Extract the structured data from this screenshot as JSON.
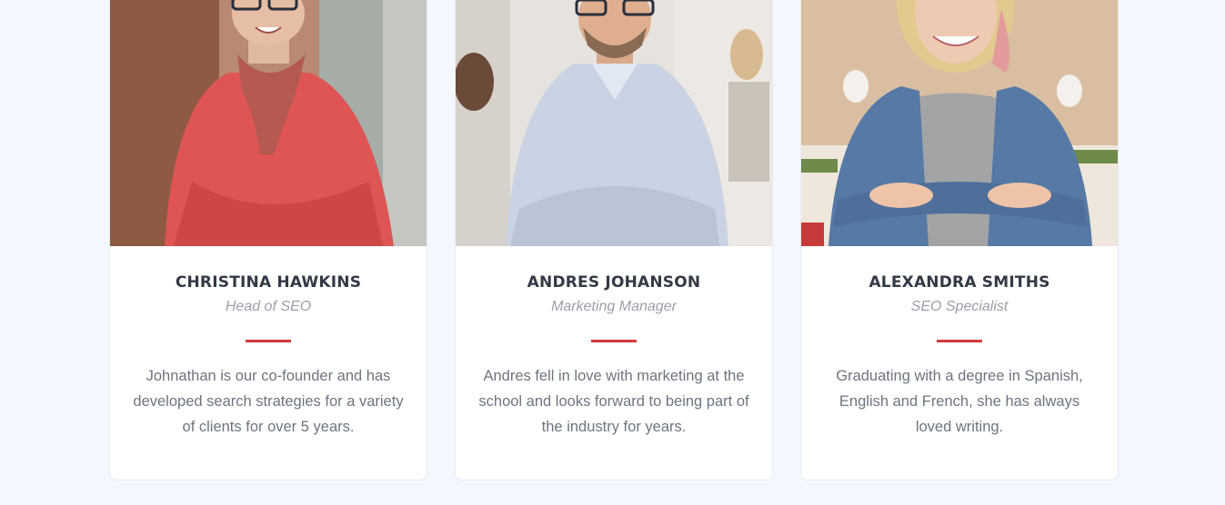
{
  "team": [
    {
      "name": "CHRISTINA HAWKINS",
      "role": "Head of SEO",
      "bio": "Johnathan is our co-founder and has developed search strategies for a variety of clients for over 5 years.",
      "photo_icon": "portrait-woman-red-sweater"
    },
    {
      "name": "ANDRES JOHANSON",
      "role": "Marketing Manager",
      "bio": "Andres fell in love with marketing at the school and looks forward to being part of the industry for years.",
      "photo_icon": "portrait-man-shirt"
    },
    {
      "name": "ALEXANDRA SMITHS",
      "role": "SEO Specialist",
      "bio": "Graduating with a degree in Spanish, English and French, she has always loved writing.",
      "photo_icon": "portrait-woman-denim"
    }
  ],
  "colors": {
    "page_bg": "#f2f8fe",
    "card_bg": "#ffffff",
    "accent": "#d13b3b",
    "name_text": "#333a45",
    "role_text": "#9aa0a8",
    "bio_text": "#6d7580"
  }
}
